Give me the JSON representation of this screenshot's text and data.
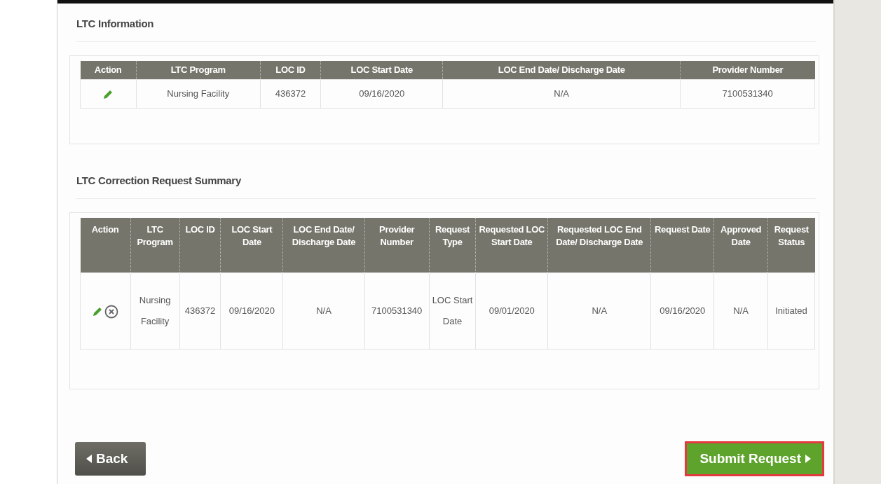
{
  "sections": [
    {
      "title": "LTC Information",
      "table": {
        "columns": [
          "Action",
          "LTC Program",
          "LOC ID",
          "LOC Start Date",
          "LOC End Date/ Discharge Date",
          "Provider Number"
        ],
        "rows": [
          {
            "editable": true,
            "cancelable": false,
            "cells": [
              "",
              "Nursing Facility",
              "436372",
              "09/16/2020",
              "N/A",
              "7100531340"
            ]
          }
        ]
      }
    },
    {
      "title": "LTC Correction Request Summary",
      "table": {
        "columns": [
          "Action",
          "LTC Program",
          "LOC ID",
          "LOC Start Date",
          "LOC End Date/ Discharge Date",
          "Provider Number",
          "Request Type",
          "Requested LOC Start Date",
          "Requested LOC End Date/ Discharge Date",
          "Request Date",
          "Approved Date",
          "Request Status"
        ],
        "rows": [
          {
            "editable": true,
            "cancelable": true,
            "cells": [
              "",
              "Nursing Facility",
              "436372",
              "09/16/2020",
              "N/A",
              "7100531340",
              "LOC Start Date",
              "09/01/2020",
              "N/A",
              "09/16/2020",
              "N/A",
              "Initiated"
            ]
          }
        ]
      }
    }
  ],
  "buttons": [
    {
      "kind": "back",
      "label": "Back",
      "highlighted": false
    },
    {
      "kind": "submit",
      "label": "Submit Request",
      "highlighted": true
    }
  ]
}
